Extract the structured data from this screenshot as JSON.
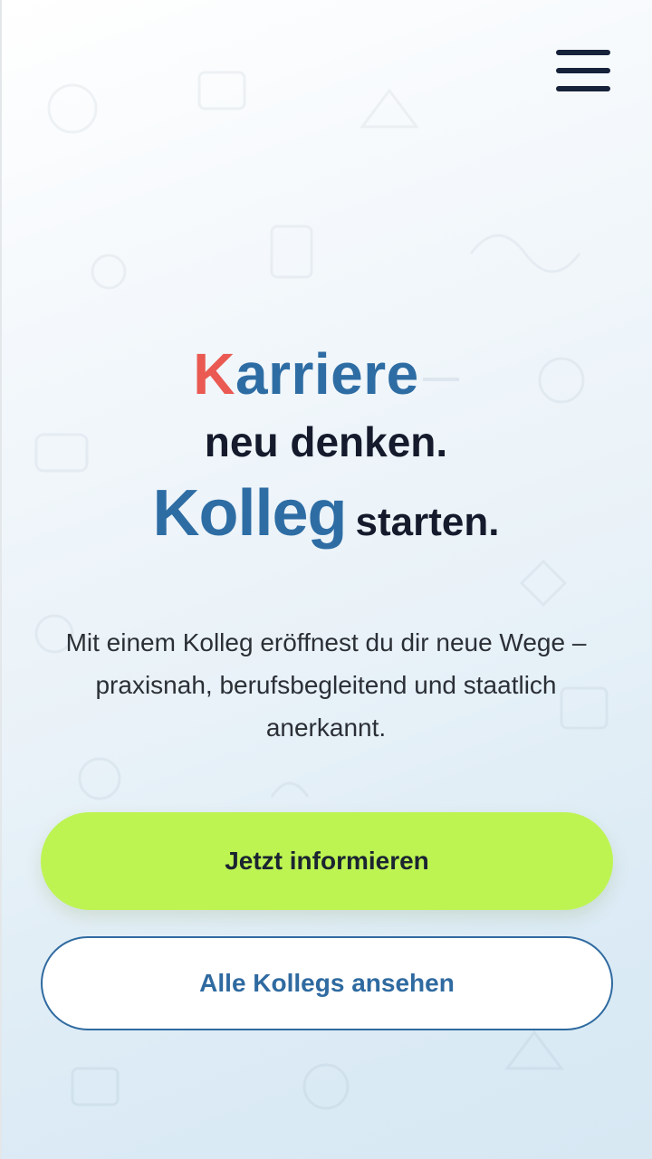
{
  "header": {
    "menu_icon": "hamburger-menu-icon"
  },
  "hero": {
    "headline_karriere_initial": "K",
    "headline_karriere_rest": "arriere",
    "headline_line2": "neu denken.",
    "headline_kolleg": "Kolleg",
    "headline_starten": "starten.",
    "description": "Mit einem Kolleg eröffnest du dir neue Wege – praxisnah, berufsbegleitend und staatlich anerkannt."
  },
  "actions": {
    "primary_label": "Jetzt informieren",
    "secondary_label": "Alle Kollegs ansehen"
  },
  "colors": {
    "accent_red": "#ea5a52",
    "brand_blue": "#2e6da4",
    "primary_button": "#bdf452",
    "text_dark": "#151b2c"
  }
}
